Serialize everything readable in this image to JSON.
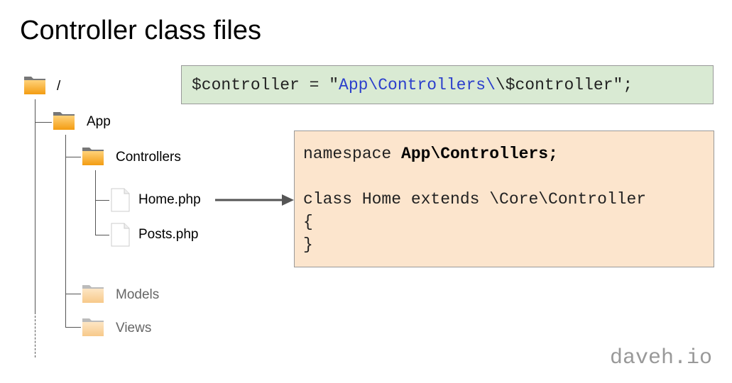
{
  "title": "Controller class files",
  "tree": {
    "root_label": "/",
    "app_label": "App",
    "controllers_label": "Controllers",
    "home_file": "Home.php",
    "posts_file": "Posts.php",
    "models_label": "Models",
    "views_label": "Views"
  },
  "green_code": {
    "prefix": "$controller = \"",
    "namespace": "App\\Controllers\\",
    "suffix": "\\$controller\";"
  },
  "class_code": {
    "ns_keyword": "namespace ",
    "ns_name": "App\\Controllers;",
    "class_decl": "class Home extends \\Core\\Controller",
    "open_brace": "{",
    "close_brace": "}"
  },
  "watermark": "daveh.io",
  "colors": {
    "folder_active": "#f6a623",
    "folder_faded": "#fad9a8",
    "green_box": "#d9ead3",
    "orange_box": "#fce5cd",
    "namespace_blue": "#2b3fcc"
  }
}
